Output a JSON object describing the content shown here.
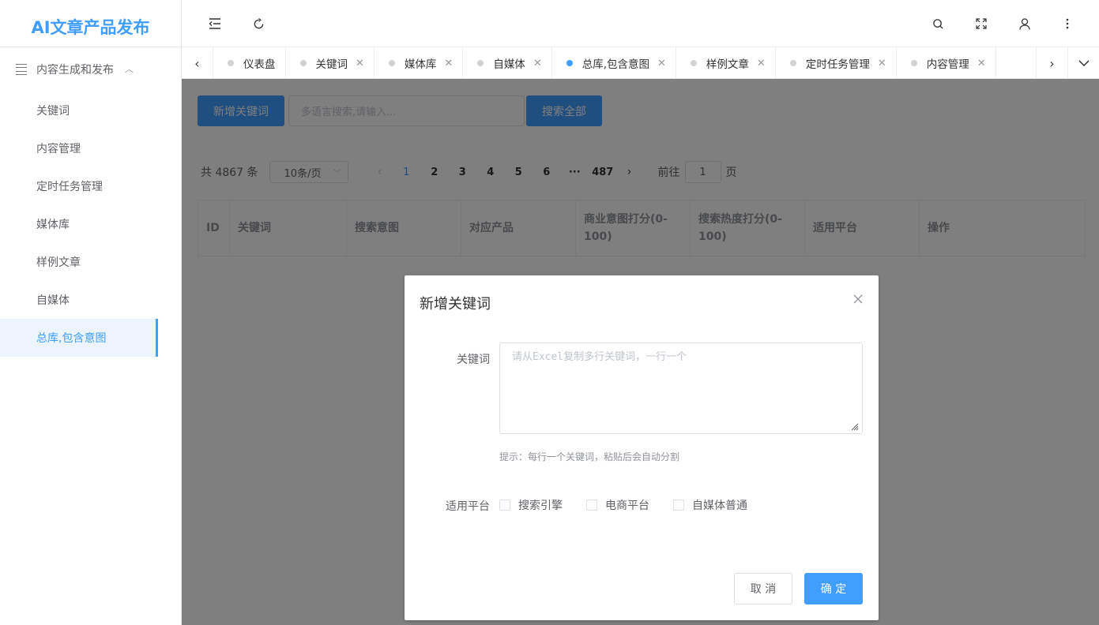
{
  "app": {
    "title": "AI文章产品发布"
  },
  "sidebar": {
    "group_label": "内容生成和发布",
    "items": [
      {
        "label": "关键词"
      },
      {
        "label": "内容管理"
      },
      {
        "label": "定时任务管理"
      },
      {
        "label": "媒体库"
      },
      {
        "label": "样例文章"
      },
      {
        "label": "自媒体"
      },
      {
        "label": "总库,包含意图",
        "active": true
      }
    ]
  },
  "tabs": [
    {
      "label": "仪表盘",
      "closable": false
    },
    {
      "label": "关键词",
      "closable": true
    },
    {
      "label": "媒体库",
      "closable": true
    },
    {
      "label": "自媒体",
      "closable": true
    },
    {
      "label": "总库,包含意图",
      "closable": true,
      "active": true
    },
    {
      "label": "样例文章",
      "closable": true
    },
    {
      "label": "定时任务管理",
      "closable": true
    },
    {
      "label": "内容管理",
      "closable": true
    }
  ],
  "toolbar": {
    "add_label": "新增关键词",
    "search_placeholder": "多语言搜索,请输入...",
    "search_all_label": "搜索全部"
  },
  "pagination": {
    "total_text": "共 4867 条",
    "page_size": "10条/页",
    "pages": [
      "1",
      "2",
      "3",
      "4",
      "5",
      "6",
      "···",
      "487"
    ],
    "current": "1",
    "goto_label": "前往",
    "goto_value": "1",
    "page_suffix": "页"
  },
  "table": {
    "columns": [
      "ID",
      "关键词",
      "搜索意图",
      "对应产品",
      "商业意图打分(0-100)",
      "搜索热度打分(0-100)",
      "适用平台",
      "操作"
    ]
  },
  "dialog": {
    "title": "新增关键词",
    "keyword_label": "关键词",
    "keyword_placeholder": "请从Excel复制多行关键词，一行一个",
    "hint": "提示：每行一个关键词，粘贴后会自动分割",
    "platform_label": "适用平台",
    "platforms": [
      "搜索引擎",
      "电商平台",
      "自媒体普通"
    ],
    "cancel_label": "取 消",
    "ok_label": "确 定"
  },
  "colors": {
    "accent": "#409eff",
    "overlay": "rgba(0,0,0,0.5)"
  }
}
